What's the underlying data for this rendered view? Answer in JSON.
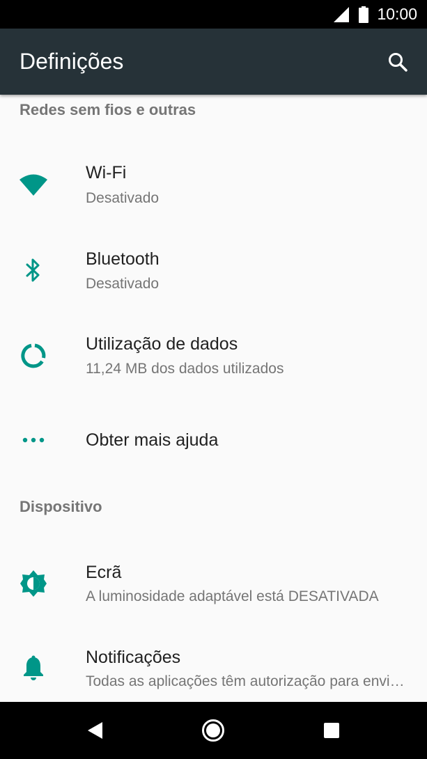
{
  "status_bar": {
    "time": "10:00",
    "icons": [
      "signal-icon",
      "battery-icon"
    ]
  },
  "app_bar": {
    "title": "Definições",
    "search_icon": "search-icon"
  },
  "colors": {
    "accent": "#009688",
    "app_bar": "#263238",
    "background": "#fafafa"
  },
  "sections": [
    {
      "header": "Redes sem fios e outras",
      "items": [
        {
          "icon": "wifi-icon",
          "title": "Wi-Fi",
          "summary": "Desativado"
        },
        {
          "icon": "bluetooth-icon",
          "title": "Bluetooth",
          "summary": "Desativado"
        },
        {
          "icon": "data-usage-icon",
          "title": "Utilização de dados",
          "summary": "11,24 MB dos dados utilizados"
        },
        {
          "icon": "more-icon",
          "title": "Obter mais ajuda"
        }
      ]
    },
    {
      "header": "Dispositivo",
      "items": [
        {
          "icon": "brightness-icon",
          "title": "Ecrã",
          "summary": "A luminosidade adaptável está DESATIVADA"
        },
        {
          "icon": "bell-icon",
          "title": "Notificações",
          "summary": "Todas as aplicações têm autorização para enviar notificações"
        }
      ]
    }
  ],
  "nav_bar": {
    "buttons": [
      "back-icon",
      "home-icon",
      "recents-icon"
    ]
  }
}
